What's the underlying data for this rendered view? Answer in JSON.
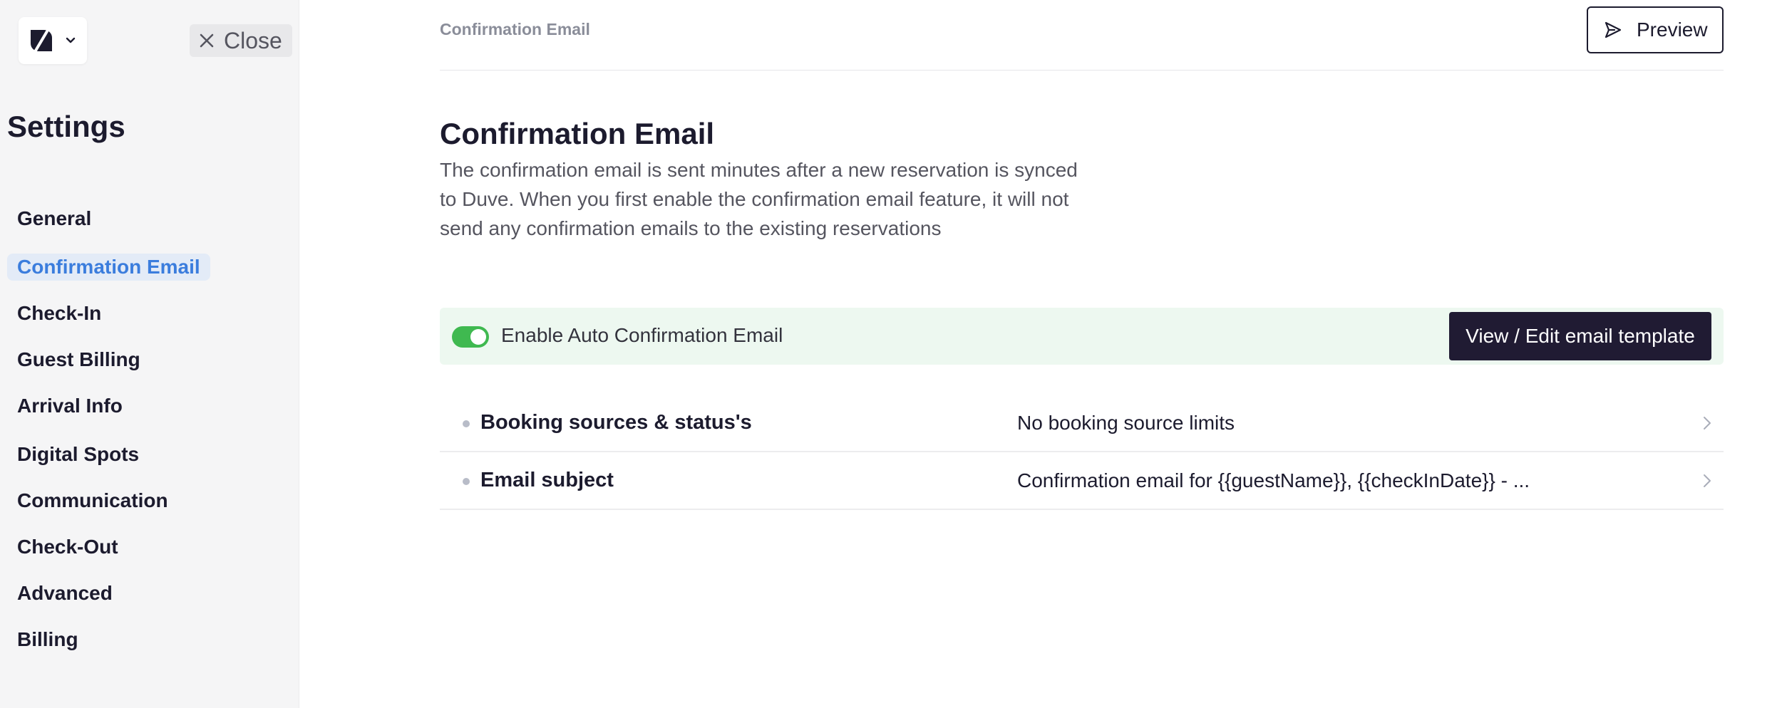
{
  "sidebar": {
    "close_label": "Close",
    "title": "Settings",
    "items": [
      {
        "label": "General",
        "active": false
      },
      {
        "label": "Confirmation Email",
        "active": true
      },
      {
        "label": "Check-In",
        "active": false
      },
      {
        "label": "Guest Billing",
        "active": false
      },
      {
        "label": "Arrival Info",
        "active": false
      },
      {
        "label": "Digital Spots",
        "active": false
      },
      {
        "label": "Communication",
        "active": false
      },
      {
        "label": "Check-Out",
        "active": false
      },
      {
        "label": "Advanced",
        "active": false
      },
      {
        "label": "Billing",
        "active": false
      }
    ]
  },
  "header": {
    "breadcrumb": "Confirmation Email",
    "preview_label": "Preview"
  },
  "main": {
    "title": "Confirmation Email",
    "description": "The confirmation email is sent minutes after a new reservation is synced to Duve. When you first enable the confirmation email feature, it will not send any confirmation emails to the existing reservations",
    "toggle": {
      "label": "Enable Auto Confirmation Email",
      "enabled": true
    },
    "edit_template_label": "View / Edit email template",
    "rows": [
      {
        "label": "Booking sources & status's",
        "value": "No booking source limits"
      },
      {
        "label": "Email subject",
        "value": "Confirmation email for {{guestName}}, {{checkInDate}} - ..."
      }
    ]
  },
  "colors": {
    "accent": "#3b7ddd",
    "toggle_on": "#3fb950",
    "primary_button": "#201b33",
    "toggle_bar_bg": "#edf8f0"
  }
}
